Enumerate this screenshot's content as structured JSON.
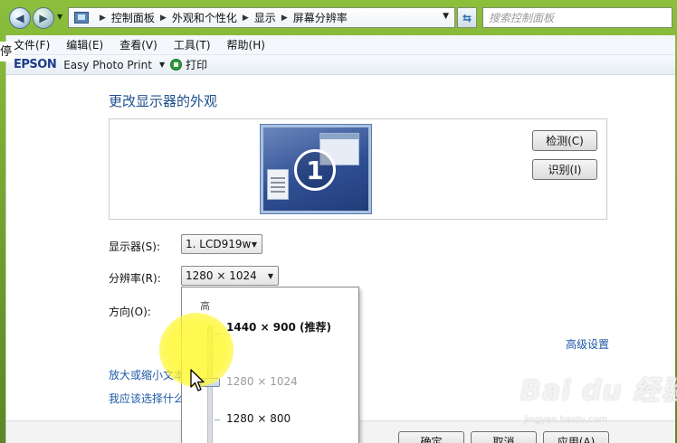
{
  "addressbar": {
    "crumbs": [
      "控制面板",
      "外观和个性化",
      "显示",
      "屏幕分辨率"
    ],
    "search_placeholder": "搜索控制面板"
  },
  "menubar": {
    "items": [
      "文件(F)",
      "编辑(E)",
      "查看(V)",
      "工具(T)",
      "帮助(H)"
    ],
    "fragment": "停"
  },
  "toolbar": {
    "brand": "EPSON",
    "product": "Easy Photo Print",
    "print_label": "打印"
  },
  "content": {
    "title": "更改显示器的外观",
    "monitor_number": "1",
    "detect_button": "检测(C)",
    "identify_button": "识别(I)",
    "display_label": "显示器(S):",
    "display_value": "1. LCD919w",
    "resolution_label": "分辨率(R):",
    "resolution_value": "1280 × 1024",
    "orientation_label": "方向(O):",
    "advanced_link": "高级设置",
    "zoom_link": "放大或缩小文本",
    "choose_link": "我应该选择什么"
  },
  "dropdown": {
    "high_label": "高",
    "options": [
      "1440 × 900 (推荐)",
      "1280 × 1024",
      "1280 × 800"
    ],
    "selected_value": "1280 × 1024"
  },
  "footer": {
    "ok": "确定",
    "cancel": "取消",
    "apply": "应用(A)"
  },
  "watermark": {
    "text": "Bai du 经验",
    "url": "jingyan.baidu.com"
  },
  "colors": {
    "frame_green": "#6f9b2e",
    "link_blue": "#1e5aa8",
    "title_blue": "#1e4e8c",
    "highlight_yellow": "#fff73c"
  }
}
